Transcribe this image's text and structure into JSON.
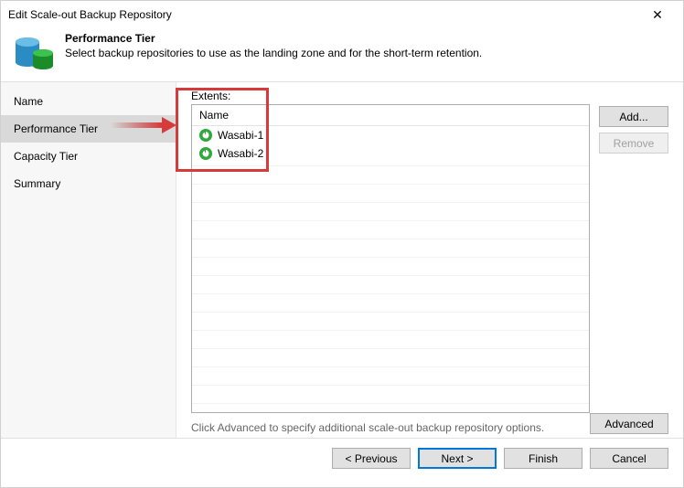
{
  "window": {
    "title": "Edit Scale-out Backup Repository"
  },
  "header": {
    "title": "Performance Tier",
    "subtitle": "Select backup repositories to use as the landing zone and for the short-term retention."
  },
  "sidebar": {
    "items": [
      {
        "label": "Name"
      },
      {
        "label": "Performance Tier"
      },
      {
        "label": "Capacity Tier"
      },
      {
        "label": "Summary"
      }
    ],
    "active_index": 1
  },
  "panel": {
    "extents_label": "Extents:",
    "column_header": "Name",
    "rows": [
      {
        "label": "Wasabi-1"
      },
      {
        "label": "Wasabi-2"
      }
    ],
    "hint": "Click Advanced to specify additional scale-out backup repository options."
  },
  "buttons": {
    "add": "Add...",
    "remove": "Remove",
    "advanced": "Advanced",
    "previous": "< Previous",
    "next": "Next >",
    "finish": "Finish",
    "cancel": "Cancel"
  }
}
